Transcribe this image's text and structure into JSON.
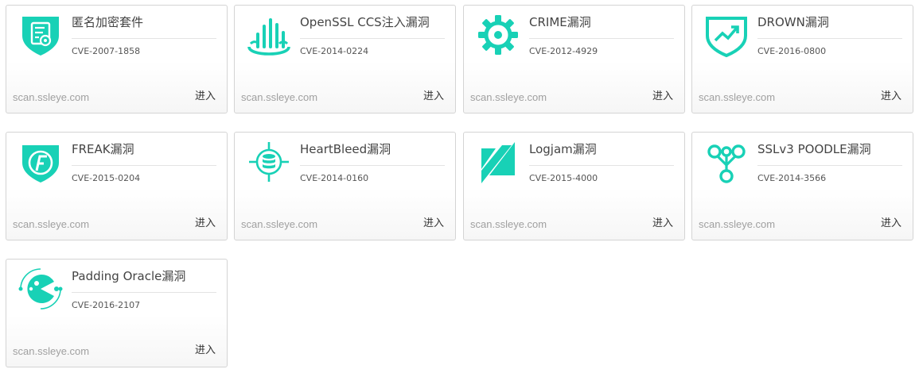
{
  "brand_color": "#18d1b6",
  "cards": [
    {
      "icon": "shield-certificate-icon",
      "title": "匿名加密套件",
      "cve": "CVE-2007-1858",
      "site": "scan.ssleye.com",
      "enter": "进入"
    },
    {
      "icon": "heartbeat-bars-icon",
      "title": "OpenSSL CCS注入漏洞",
      "cve": "CVE-2014-0224",
      "site": "scan.ssleye.com",
      "enter": "进入"
    },
    {
      "icon": "gear-icon",
      "title": "CRIME漏洞",
      "cve": "CVE-2012-4929",
      "site": "scan.ssleye.com",
      "enter": "进入"
    },
    {
      "icon": "shield-trend-icon",
      "title": "DROWN漏洞",
      "cve": "CVE-2016-0800",
      "site": "scan.ssleye.com",
      "enter": "进入"
    },
    {
      "icon": "shield-f-icon",
      "title": "FREAK漏洞",
      "cve": "CVE-2015-0204",
      "site": "scan.ssleye.com",
      "enter": "进入"
    },
    {
      "icon": "target-database-icon",
      "title": "HeartBleed漏洞",
      "cve": "CVE-2014-0160",
      "site": "scan.ssleye.com",
      "enter": "进入"
    },
    {
      "icon": "logjam-slash-icon",
      "title": "Logjam漏洞",
      "cve": "CVE-2015-4000",
      "site": "scan.ssleye.com",
      "enter": "进入"
    },
    {
      "icon": "nodes-tree-icon",
      "title": "SSLv3 POODLE漏洞",
      "cve": "CVE-2014-3566",
      "site": "scan.ssleye.com",
      "enter": "进入"
    },
    {
      "icon": "padding-oracle-icon",
      "title": "Padding Oracle漏洞",
      "cve": "CVE-2016-2107",
      "site": "scan.ssleye.com",
      "enter": "进入"
    }
  ]
}
